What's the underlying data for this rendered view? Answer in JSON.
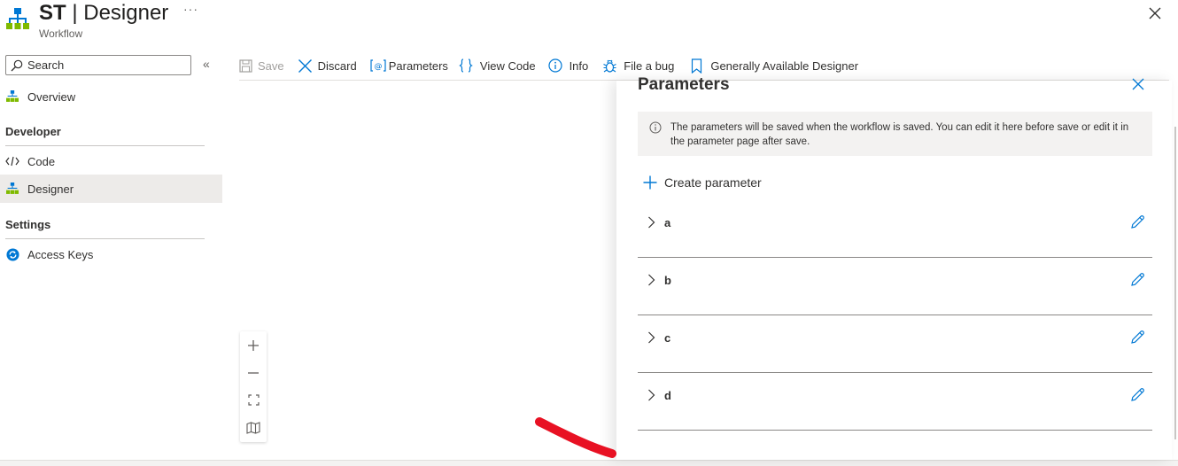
{
  "header": {
    "title_bold": "ST",
    "title_rest": " | Designer",
    "subtitle": "Workflow",
    "more": "···"
  },
  "sidebar": {
    "search_placeholder": "Search",
    "collapse": "«",
    "items": [
      {
        "label": "Overview"
      },
      {
        "label": "Code"
      },
      {
        "label": "Designer",
        "selected": true
      },
      {
        "label": "Access Keys"
      }
    ],
    "sections": [
      {
        "label": "Developer"
      },
      {
        "label": "Settings"
      }
    ]
  },
  "toolbar": {
    "save": "Save",
    "discard": "Discard",
    "parameters": "Parameters",
    "view_code": "View Code",
    "info": "Info",
    "file_bug": "File a bug",
    "ga_designer": "Generally Available Designer"
  },
  "panel": {
    "title": "Parameters",
    "info_text": "The parameters will be saved when the workflow is saved. You can edit it here before save or edit it in the parameter page after save.",
    "create_label": "Create parameter",
    "params": [
      {
        "name": "a"
      },
      {
        "name": "b"
      },
      {
        "name": "c"
      },
      {
        "name": "d"
      }
    ]
  },
  "colors": {
    "accent": "#0078d4",
    "selected_bg": "#edebe9",
    "annotation": "#e81123"
  },
  "icons": {
    "app": "workflow-icon",
    "search": "search-icon",
    "overview": "workflow-icon",
    "code": "code-icon",
    "designer": "workflow-icon",
    "access_keys": "refresh-key-icon"
  }
}
